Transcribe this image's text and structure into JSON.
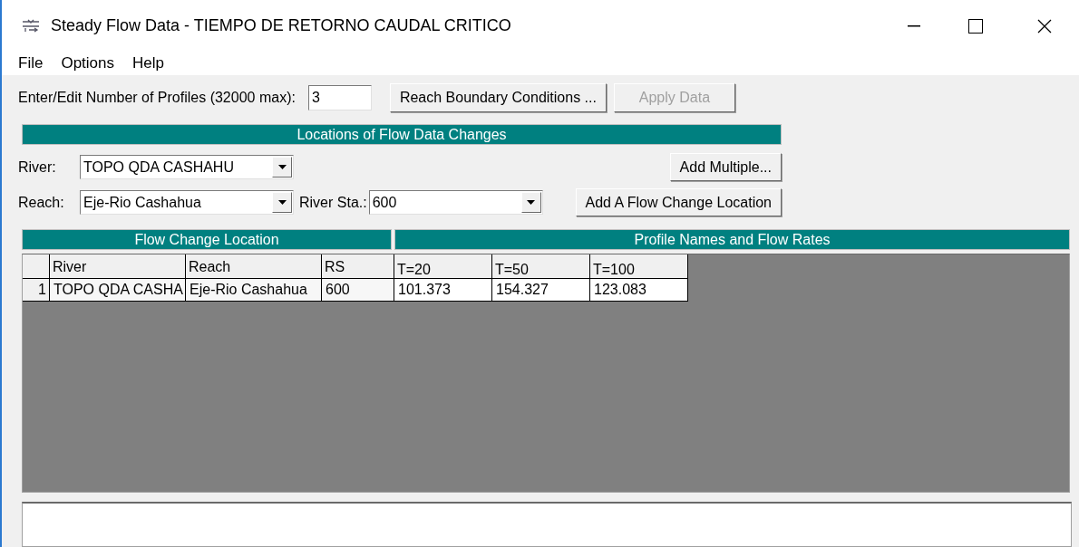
{
  "window": {
    "title": "Steady Flow Data - TIEMPO DE RETORNO CAUDAL CRITICO"
  },
  "menu": [
    "File",
    "Options",
    "Help"
  ],
  "profiles": {
    "label": "Enter/Edit Number of Profiles (32000 max):",
    "value": "3"
  },
  "top_buttons": [
    {
      "label": "Reach Boundary Conditions ...",
      "disabled": false
    },
    {
      "label": "Apply Data",
      "disabled": true
    }
  ],
  "locations": {
    "title": "Locations of Flow Data Changes",
    "river": {
      "label": "River:",
      "value": "TOPO QDA CASHAHU"
    },
    "reach": {
      "label": "Reach:",
      "value": "Eje-Rio Cashahua"
    },
    "river_sta": {
      "label": "River Sta.:",
      "value": "600"
    },
    "add_multiple": "Add Multiple...",
    "add_location": "Add A Flow Change Location"
  },
  "table": {
    "groups": [
      {
        "title": "Flow Change Location",
        "columns": [
          "River",
          "Reach",
          "RS"
        ]
      },
      {
        "title": "Profile Names and Flow Rates",
        "columns": [
          "T=20",
          "T=50",
          "T=100"
        ]
      }
    ],
    "rows": [
      {
        "number": "1",
        "cells": [
          "TOPO QDA CASHA",
          "Eje-Rio Cashahua",
          "600",
          "101.373",
          "154.327",
          "123.083"
        ]
      }
    ]
  }
}
